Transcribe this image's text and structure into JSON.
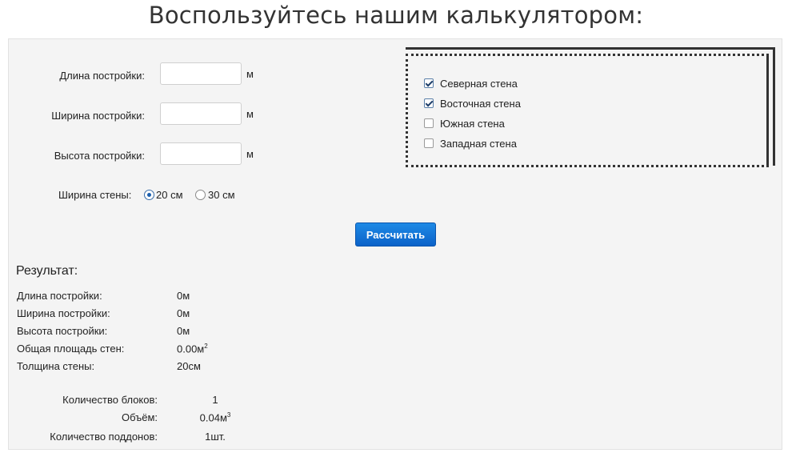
{
  "page": {
    "title": "Воспользуйтесь нашим калькулятором:"
  },
  "form": {
    "length_label": "Длина постройки:",
    "width_label": "Ширина постройки:",
    "height_label": "Высота постройки:",
    "length_value": "",
    "width_value": "",
    "height_value": "",
    "unit": "м",
    "wall_width_label": "Ширина стены:",
    "wall_width_options": [
      {
        "label": "20 см",
        "checked": true
      },
      {
        "label": "30 см",
        "checked": false
      }
    ]
  },
  "walls": [
    {
      "label": "Северная стена",
      "checked": true
    },
    {
      "label": "Восточная стена",
      "checked": true
    },
    {
      "label": "Южная стена",
      "checked": false
    },
    {
      "label": "Западная стена",
      "checked": false
    }
  ],
  "calculate_button": "Рассчитать",
  "result": {
    "title": "Результат:",
    "rows": [
      {
        "label": "Длина постройки:",
        "value": "0м",
        "sup": ""
      },
      {
        "label": "Ширина постройки:",
        "value": "0м",
        "sup": ""
      },
      {
        "label": "Высота постройки:",
        "value": "0м",
        "sup": ""
      },
      {
        "label": "Общая площадь стен:",
        "value": "0.00м",
        "sup": "2"
      },
      {
        "label": "Толщина стены:",
        "value": "20см",
        "sup": ""
      }
    ],
    "summary": [
      {
        "label": "Количество блоков:",
        "value": "1",
        "sup": ""
      },
      {
        "label": "Объём:",
        "value": "0.04м",
        "sup": "3"
      },
      {
        "label": "Количество поддонов:",
        "value": "1шт.",
        "sup": ""
      }
    ]
  }
}
